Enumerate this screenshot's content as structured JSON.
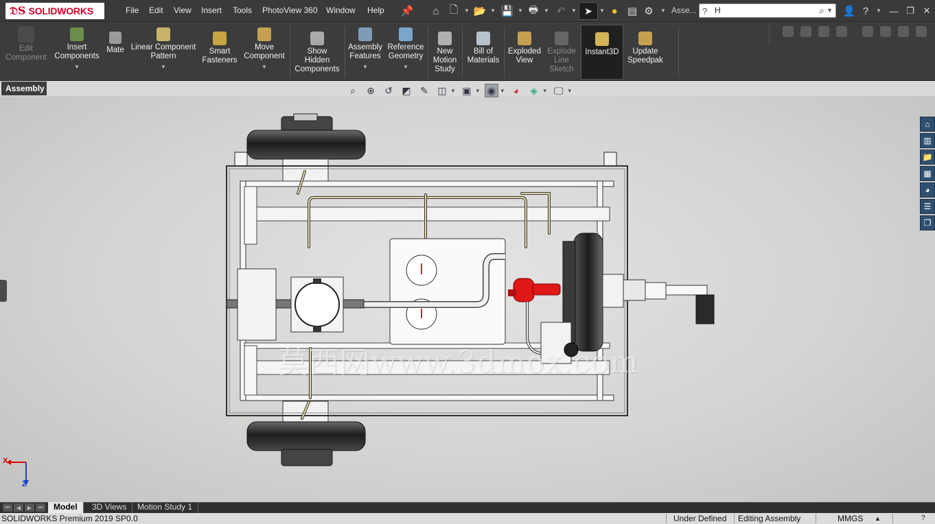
{
  "app": {
    "brand": "SOLIDWORKS",
    "search_value": "H",
    "doc_short": "Asse..."
  },
  "menu": [
    "File",
    "Edit",
    "View",
    "Insert",
    "Tools",
    "PhotoView 360",
    "Window",
    "Help"
  ],
  "ribbon": {
    "edit_component": "Edit\nComponent",
    "insert_components": "Insert\nComponents",
    "mate": "Mate",
    "linear_pattern": "Linear Component\nPattern",
    "smart_fasteners": "Smart\nFasteners",
    "move_component": "Move\nComponent",
    "show_hidden": "Show\nHidden\nComponents",
    "assembly_features": "Assembly\nFeatures",
    "reference_geometry": "Reference\nGeometry",
    "new_motion_study": "New\nMotion\nStudy",
    "bill_of_materials": "Bill of\nMaterials",
    "exploded_view": "Exploded\nView",
    "explode_line_sketch": "Explode\nLine\nSketch",
    "instant3d": "Instant3D",
    "update_speedpak": "Update\nSpeedpak"
  },
  "tabs": {
    "assembly": "Assembly"
  },
  "watermark": "莫西网www.3dmox.com",
  "triad": {
    "x": "X",
    "z": "Z"
  },
  "bottom_tabs": [
    "Model",
    "3D Views",
    "Motion Study 1"
  ],
  "status": {
    "product": "SOLIDWORKS Premium 2019 SP0.0",
    "defined": "Under Defined",
    "mode": "Editing Assembly",
    "units": "MMGS"
  },
  "colors": {
    "accent_red": "#d6002a",
    "valve_red": "#e01818",
    "frame_white": "#f7f7f7",
    "wheel_dark": "#3a3a3a"
  }
}
